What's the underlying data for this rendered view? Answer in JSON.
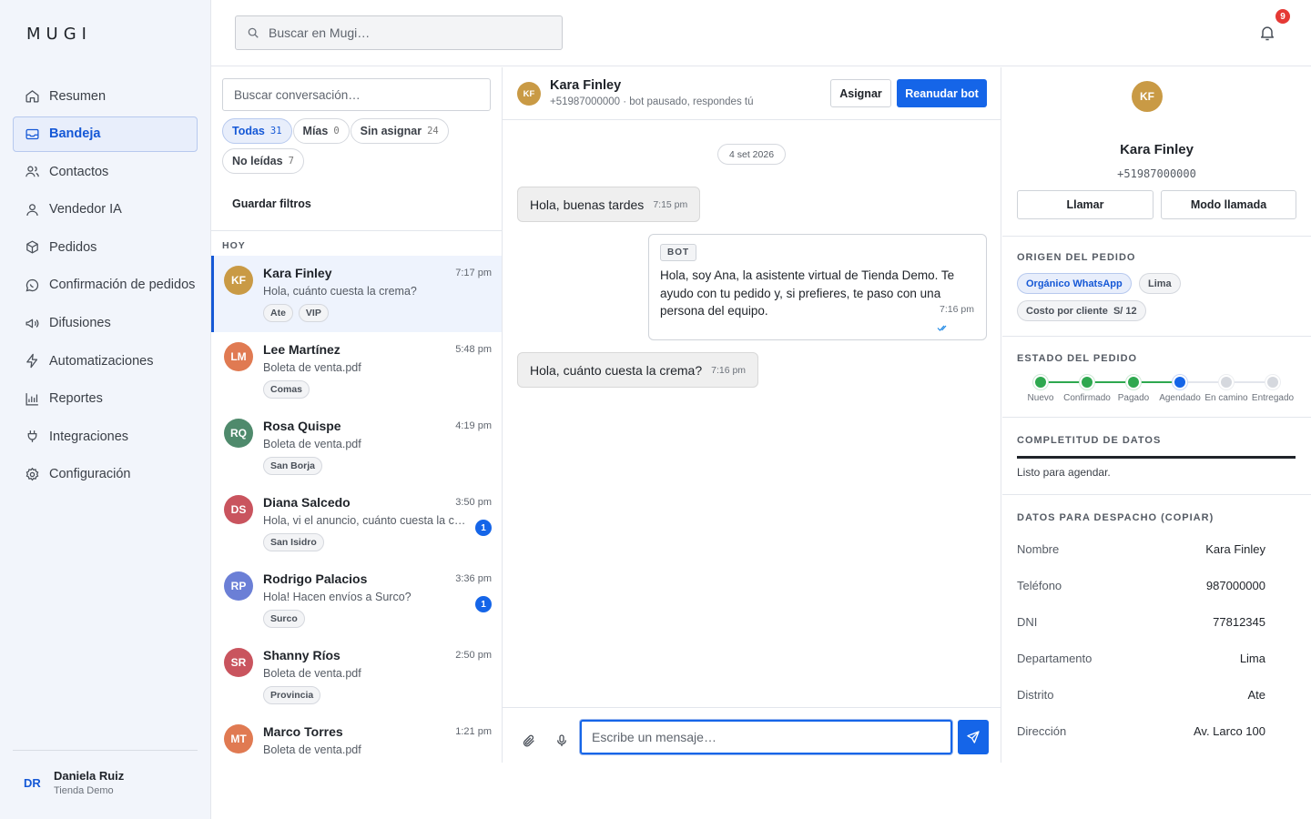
{
  "app": {
    "logo": "MUGI"
  },
  "sidebar": {
    "items": [
      {
        "label": "Resumen",
        "icon": "home-icon",
        "active": false
      },
      {
        "label": "Bandeja",
        "icon": "inbox-icon",
        "active": true
      },
      {
        "label": "Contactos",
        "icon": "users-icon",
        "active": false
      },
      {
        "label": "Vendedor IA",
        "icon": "user-icon",
        "active": false
      },
      {
        "label": "Pedidos",
        "icon": "box-icon",
        "active": false
      },
      {
        "label": "Confirmación de pedidos",
        "icon": "whatsapp-icon",
        "active": false
      },
      {
        "label": "Difusiones",
        "icon": "megaphone-icon",
        "active": false
      },
      {
        "label": "Automatizaciones",
        "icon": "lightning-icon",
        "active": false
      },
      {
        "label": "Reportes",
        "icon": "bar-chart-icon",
        "active": false
      },
      {
        "label": "Integraciones",
        "icon": "plug-icon",
        "active": false
      },
      {
        "label": "Configuración",
        "icon": "gear-icon",
        "active": false
      }
    ],
    "user": {
      "initials": "DR",
      "name": "Daniela Ruiz",
      "store": "Tienda Demo"
    }
  },
  "topbar": {
    "search_placeholder": "Buscar en Mugi…",
    "notifications_count": "9"
  },
  "conversations": {
    "search_placeholder": "Buscar conversación…",
    "filters": [
      {
        "label": "Todas",
        "count": "31",
        "active": true
      },
      {
        "label": "Mías",
        "count": "0",
        "active": false
      },
      {
        "label": "Sin asignar",
        "count": "24",
        "active": false
      },
      {
        "label": "No leídas",
        "count": "7",
        "active": false
      }
    ],
    "save_filters": "Guardar filtros",
    "section": "HOY",
    "items": [
      {
        "initials": "KF",
        "color": "#c99a45",
        "name": "Kara Finley",
        "time": "7:17 pm",
        "preview": "Hola, cuánto cuesta la crema?",
        "tags": [
          "Ate",
          "VIP"
        ],
        "unread": "",
        "active": true
      },
      {
        "initials": "LM",
        "color": "#e07a52",
        "name": "Lee Martínez",
        "time": "5:48 pm",
        "preview": "Boleta de venta.pdf",
        "tags": [
          "Comas"
        ],
        "unread": "",
        "active": false
      },
      {
        "initials": "RQ",
        "color": "#4f8a6c",
        "name": "Rosa Quispe",
        "time": "4:19 pm",
        "preview": "Boleta de venta.pdf",
        "tags": [
          "San Borja"
        ],
        "unread": "",
        "active": false
      },
      {
        "initials": "DS",
        "color": "#c9545e",
        "name": "Diana Salcedo",
        "time": "3:50 pm",
        "preview": "Hola, vi el anuncio, cuánto cuesta la crema?",
        "tags": [
          "San Isidro"
        ],
        "unread": "1",
        "active": false
      },
      {
        "initials": "RP",
        "color": "#6b7fd6",
        "name": "Rodrigo Palacios",
        "time": "3:36 pm",
        "preview": "Hola! Hacen envíos a Surco?",
        "tags": [
          "Surco"
        ],
        "unread": "1",
        "active": false
      },
      {
        "initials": "SR",
        "color": "#c9545e",
        "name": "Shanny Ríos",
        "time": "2:50 pm",
        "preview": "Boleta de venta.pdf",
        "tags": [
          "Provincia"
        ],
        "unread": "",
        "active": false
      },
      {
        "initials": "MT",
        "color": "#e07a52",
        "name": "Marco Torres",
        "time": "1:21 pm",
        "preview": "Boleta de venta.pdf",
        "tags": [],
        "unread": "",
        "active": false
      }
    ]
  },
  "chat": {
    "contact_initials": "KF",
    "contact_name": "Kara Finley",
    "contact_status": "+51987000000 · bot pausado, respondes tú",
    "assign_label": "Asignar",
    "resume_label": "Reanudar bot",
    "date": "4 set 2026",
    "messages": [
      {
        "type": "in",
        "text": "Hola, buenas tardes",
        "time": "7:15 pm"
      },
      {
        "type": "bot",
        "badge": "BOT",
        "text": "Hola, soy Ana, la asistente virtual de Tienda Demo. Te ayudo con tu pedido y, si prefieres, te paso con una persona del equipo.",
        "time": "7:16 pm"
      },
      {
        "type": "in",
        "text": "Hola, cuánto cuesta la crema?",
        "time": "7:16 pm"
      }
    ],
    "input_placeholder": "Escribe un mensaje…"
  },
  "profile": {
    "initials": "KF",
    "name": "Kara Finley",
    "phone": "+51987000000",
    "call_label": "Llamar",
    "call_mode_label": "Modo llamada",
    "origin": {
      "title": "ORIGEN DEL PEDIDO",
      "tags": [
        "Orgánico WhatsApp",
        "Lima",
        "Costo por cliente  S/ 12"
      ]
    },
    "status": {
      "title": "ESTADO DEL PEDIDO",
      "steps": [
        "Nuevo",
        "Confirmado",
        "Pagado",
        "Agendado",
        "En camino",
        "Entregado"
      ],
      "completed_count": 3,
      "current_index": 3
    },
    "completeness": {
      "title": "COMPLETITUD DE DATOS",
      "value": 1.0,
      "text": "Listo para agendar."
    },
    "shipping": {
      "title": "DATOS PARA DESPACHO (COPIAR)",
      "rows": [
        {
          "label": "Nombre",
          "value": "Kara Finley"
        },
        {
          "label": "Teléfono",
          "value": "987000000"
        },
        {
          "label": "DNI",
          "value": "77812345"
        },
        {
          "label": "Departamento",
          "value": "Lima"
        },
        {
          "label": "Distrito",
          "value": "Ate"
        },
        {
          "label": "Dirección",
          "value": "Av. Larco 100"
        }
      ]
    }
  },
  "colors": {
    "accent": "#1565e8",
    "step_done": "#2ea84f",
    "step_current": "#1565e8",
    "step_pending": "#d5d8de"
  }
}
